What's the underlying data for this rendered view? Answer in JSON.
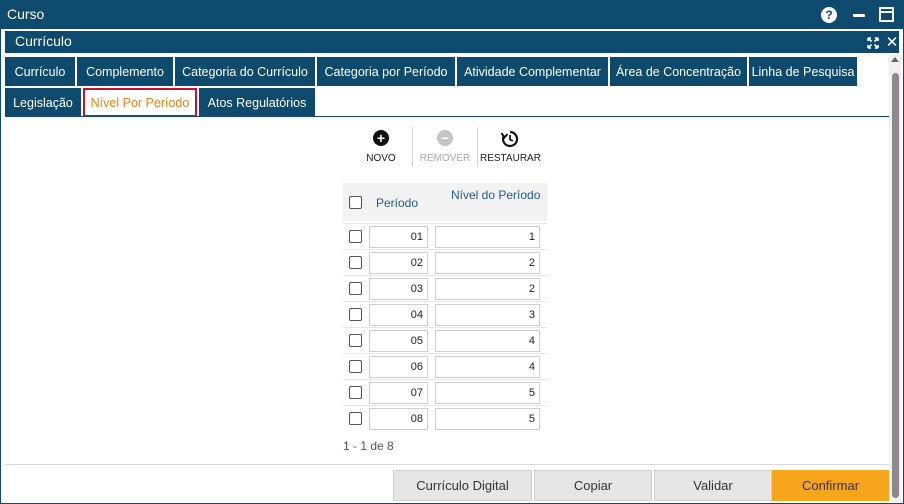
{
  "window": {
    "title": "Curso",
    "help": "?"
  },
  "panel": {
    "title": "Currículo",
    "close": "✕"
  },
  "tabs_row1": [
    "Currículo",
    "Complemento",
    "Categoria do Currículo",
    "Categoria por Período",
    "Atividade Complementar",
    "Área de Concentração",
    "Linha de Pesquisa"
  ],
  "tabs_row2": [
    "Legislação",
    "Nível Por Período",
    "Atos Regulatórios"
  ],
  "active_tab": "Nível Por Período",
  "toolbar": {
    "novo": "NOVO",
    "remover": "REMOVER",
    "restaurar": "RESTAURAR"
  },
  "grid": {
    "headers": {
      "periodo": "Período",
      "nivel": "Nível do Período"
    },
    "rows": [
      {
        "periodo": "01",
        "nivel": "1"
      },
      {
        "periodo": "02",
        "nivel": "2"
      },
      {
        "periodo": "03",
        "nivel": "2"
      },
      {
        "periodo": "04",
        "nivel": "3"
      },
      {
        "periodo": "05",
        "nivel": "4"
      },
      {
        "periodo": "06",
        "nivel": "4"
      },
      {
        "periodo": "07",
        "nivel": "5"
      },
      {
        "periodo": "08",
        "nivel": "5"
      }
    ],
    "pager": "1 - 1 de 8"
  },
  "footer": {
    "curriculo_digital": "Currículo Digital",
    "copiar": "Copiar",
    "validar": "Validar",
    "confirmar": "Confirmar"
  },
  "colors": {
    "brand": "#0e4a6e",
    "accent": "#f7a51a",
    "active_tab_text": "#e8811a",
    "active_tab_border": "#c8102e"
  }
}
